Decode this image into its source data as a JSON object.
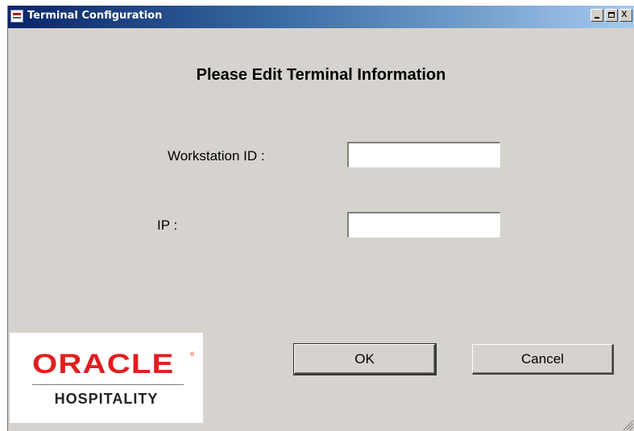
{
  "window": {
    "title": "Terminal Configuration",
    "controls": {
      "minimize": "_",
      "maximize": "□",
      "close": "x"
    }
  },
  "form": {
    "heading": "Please Edit Terminal Information",
    "workstation_label": "Workstation ID :",
    "workstation_value": "",
    "ip_label": "IP :",
    "ip_value": ""
  },
  "logo": {
    "brand": "ORACLE",
    "registered_mark": "®",
    "sub": "HOSPITALITY",
    "brand_color": "#e01e1e"
  },
  "buttons": {
    "ok_label": "OK",
    "cancel_label": "Cancel"
  },
  "icons": {
    "app": "terminal-config-icon",
    "resize": "resize-grip-icon"
  },
  "colors": {
    "titlebar_start": "#0a246a",
    "titlebar_end": "#a6caf0",
    "dialog_background": "#d6d3ce"
  }
}
